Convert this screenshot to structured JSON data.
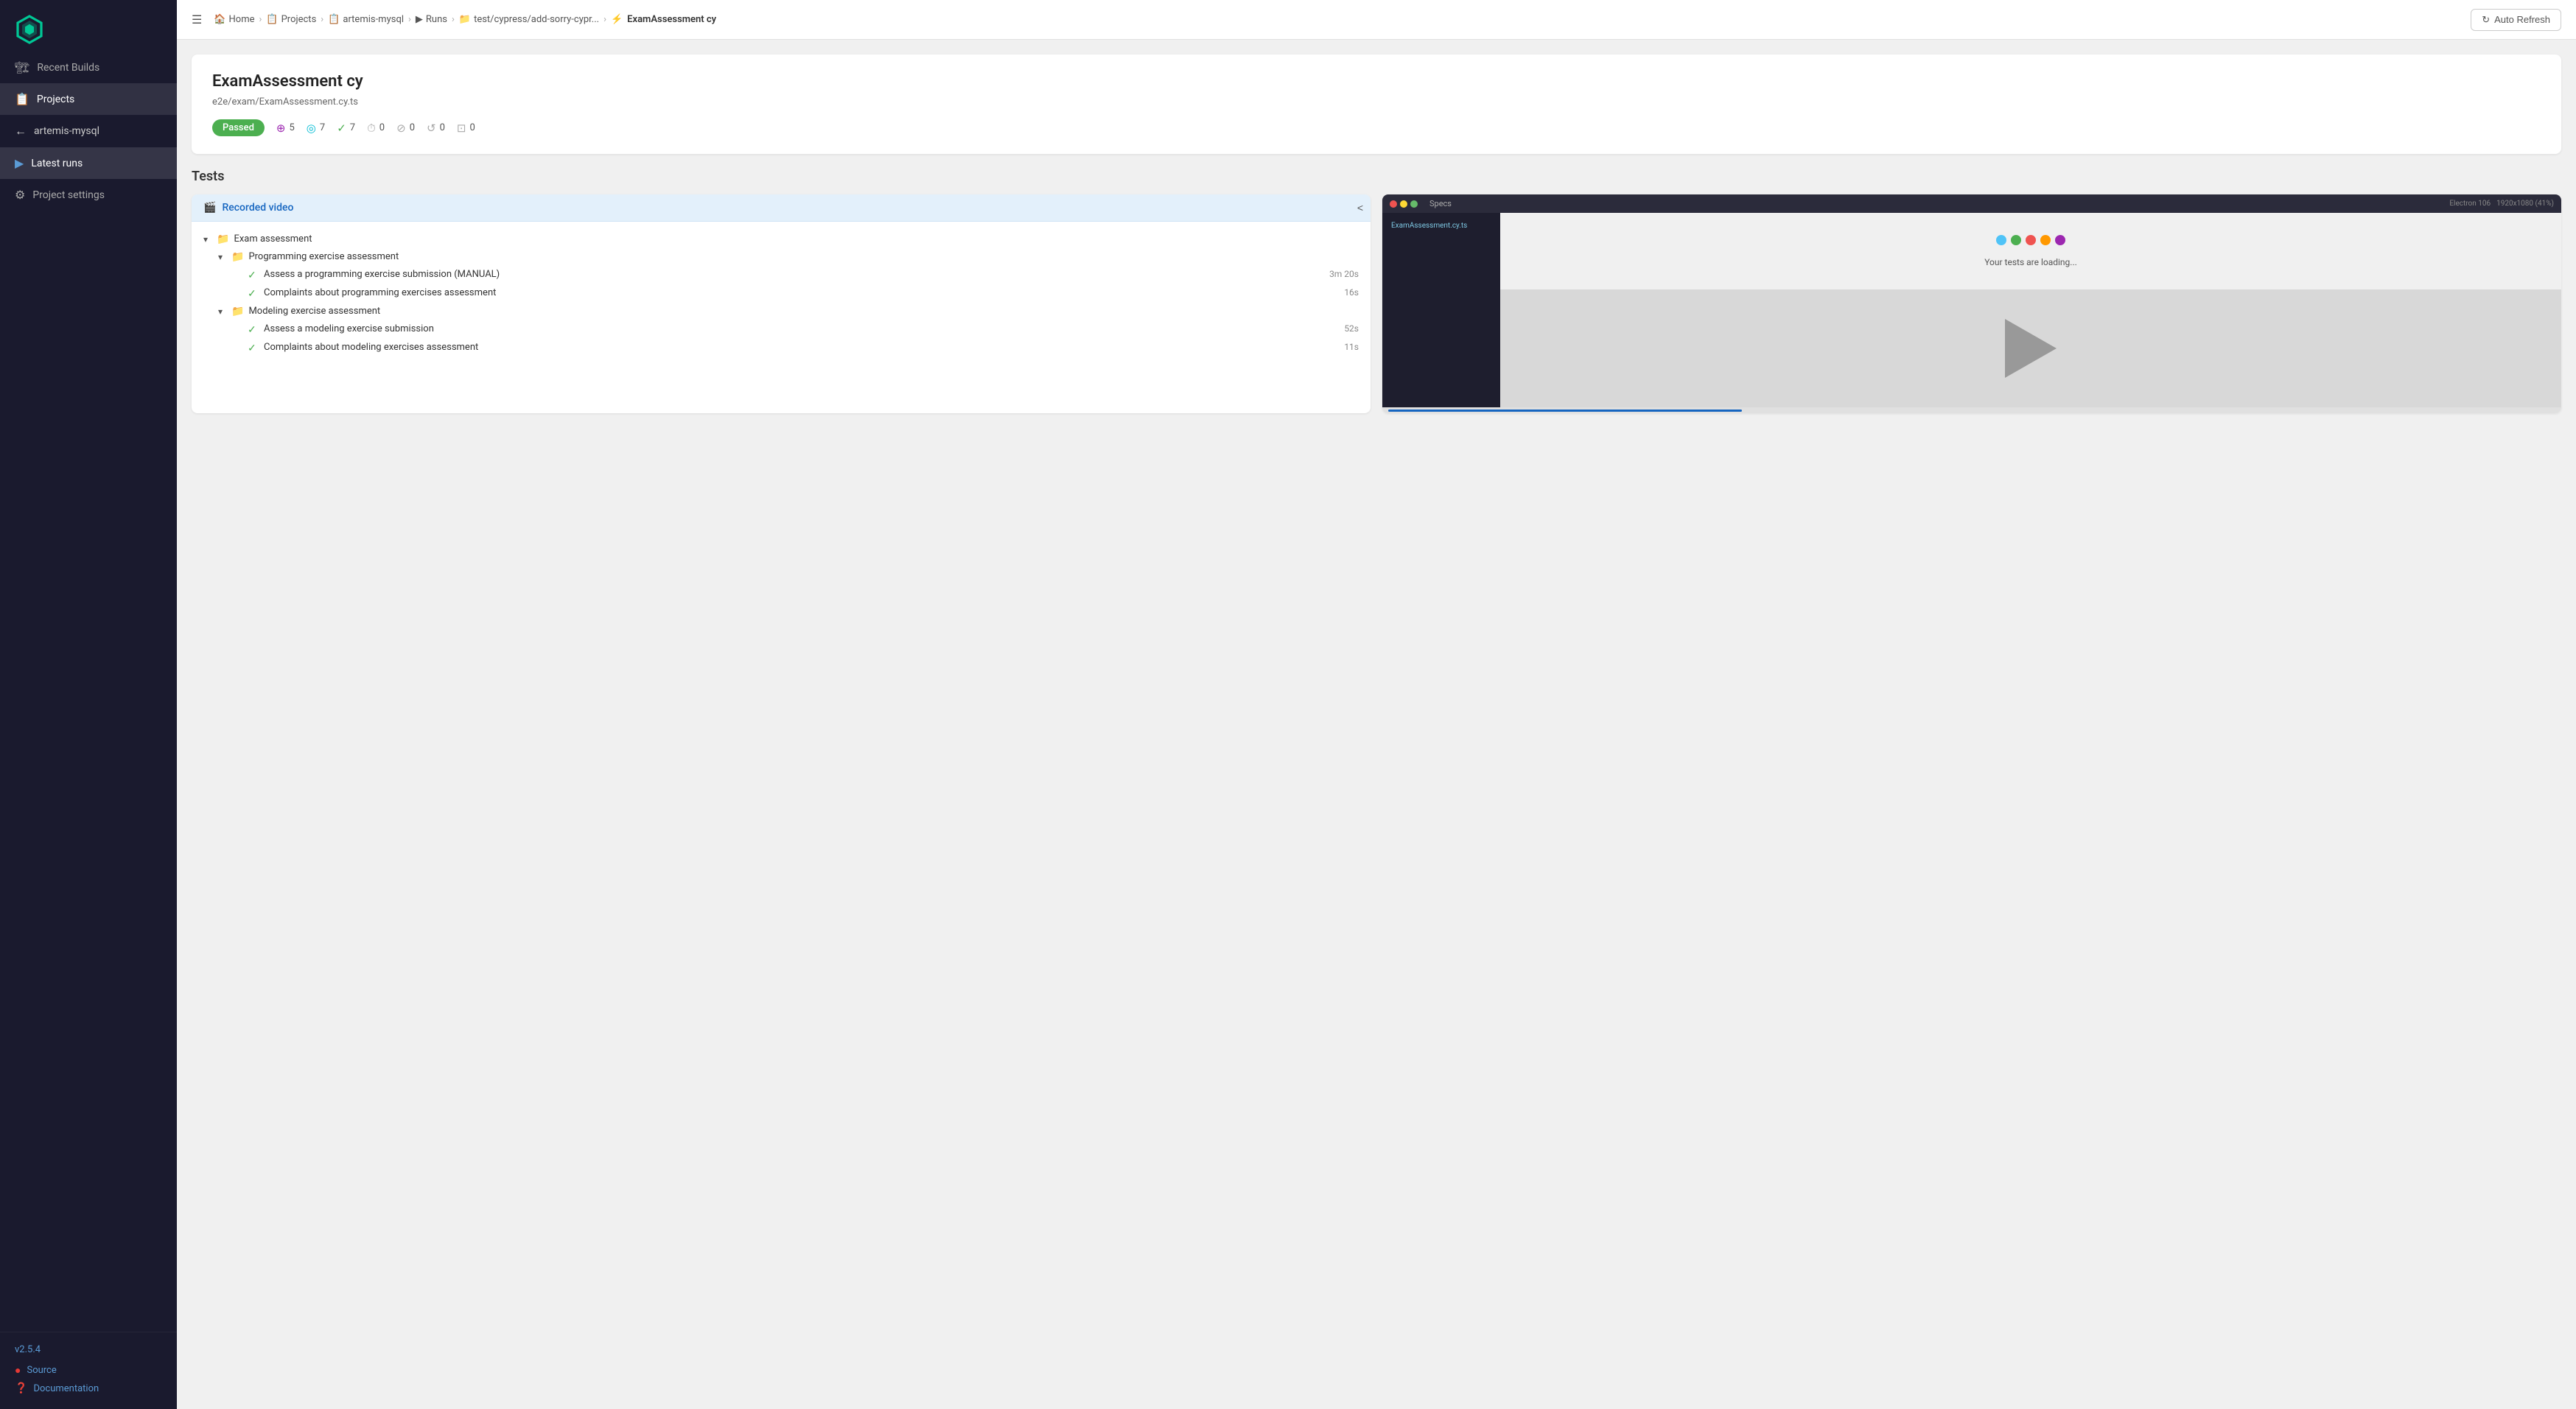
{
  "sidebar": {
    "logo_alt": "Cypress Logo",
    "items": [
      {
        "id": "recent-builds",
        "label": "Recent Builds",
        "icon": "🏗",
        "active": false
      },
      {
        "id": "projects",
        "label": "Projects",
        "icon": "📋",
        "active": false
      },
      {
        "id": "project-name",
        "label": "artemis-mysql",
        "icon": "←",
        "active": false
      },
      {
        "id": "latest-runs",
        "label": "Latest runs",
        "icon": "▶",
        "active": true
      },
      {
        "id": "project-settings",
        "label": "Project settings",
        "icon": "⚙",
        "active": false
      }
    ],
    "footer": {
      "version": "v2.5.4",
      "source_label": "Source",
      "docs_label": "Documentation"
    }
  },
  "topbar": {
    "menu_icon": "☰",
    "breadcrumbs": [
      {
        "label": "Home",
        "icon": "🏠"
      },
      {
        "label": "Projects",
        "icon": "📋"
      },
      {
        "label": "artemis-mysql",
        "icon": "📋"
      },
      {
        "label": "Runs",
        "icon": "▶"
      },
      {
        "label": "test/cypress/add-sorry-cypr...",
        "icon": "📁"
      },
      {
        "label": "ExamAssessment cy",
        "icon": "⚡",
        "current": true
      }
    ],
    "auto_refresh_label": "Auto Refresh"
  },
  "info_card": {
    "title": "ExamAssessment cy",
    "filepath": "e2e/exam/ExamAssessment.cy.ts",
    "status": "Passed",
    "stats": [
      {
        "icon": "◉",
        "color": "purple",
        "value": "5"
      },
      {
        "icon": "◎",
        "color": "cyan",
        "value": "7"
      },
      {
        "icon": "✓",
        "color": "green",
        "value": "7"
      },
      {
        "icon": "⏱",
        "color": "gray",
        "value": "0"
      },
      {
        "icon": "⊘",
        "color": "gray",
        "value": "0"
      },
      {
        "icon": "↺",
        "color": "gray",
        "value": "0"
      },
      {
        "icon": "⊡",
        "color": "gray",
        "value": "0"
      }
    ]
  },
  "tests_section": {
    "heading": "Tests",
    "left_panel": {
      "recorded_video_label": "Recorded video",
      "collapse_icon": "<",
      "tree": [
        {
          "level": 0,
          "type": "folder",
          "label": "Exam assessment",
          "expanded": true
        },
        {
          "level": 1,
          "type": "folder",
          "label": "Programming exercise assessment",
          "expanded": true
        },
        {
          "level": 2,
          "type": "test",
          "label": "Assess a programming exercise submission (MANUAL)",
          "duration": "3m 20s",
          "status": "pass"
        },
        {
          "level": 2,
          "type": "test",
          "label": "Complaints about programming exercises assessment",
          "duration": "16s",
          "status": "pass"
        },
        {
          "level": 1,
          "type": "folder",
          "label": "Modeling exercise assessment",
          "expanded": true
        },
        {
          "level": 2,
          "type": "test",
          "label": "Assess a modeling exercise submission",
          "duration": "52s",
          "status": "pass"
        },
        {
          "level": 2,
          "type": "test",
          "label": "Complaints about modeling exercises assessment",
          "duration": "11s",
          "status": "pass"
        }
      ]
    },
    "right_panel": {
      "window_title": "Specs",
      "spec_file": "ExamAssessment.cy.ts",
      "resolution": "Electron 106",
      "screen_size": "1920x1080 (41%)",
      "loading_text": "Your tests are loading...",
      "dots": [
        "cyan",
        "green",
        "red",
        "orange",
        "purple"
      ]
    }
  }
}
